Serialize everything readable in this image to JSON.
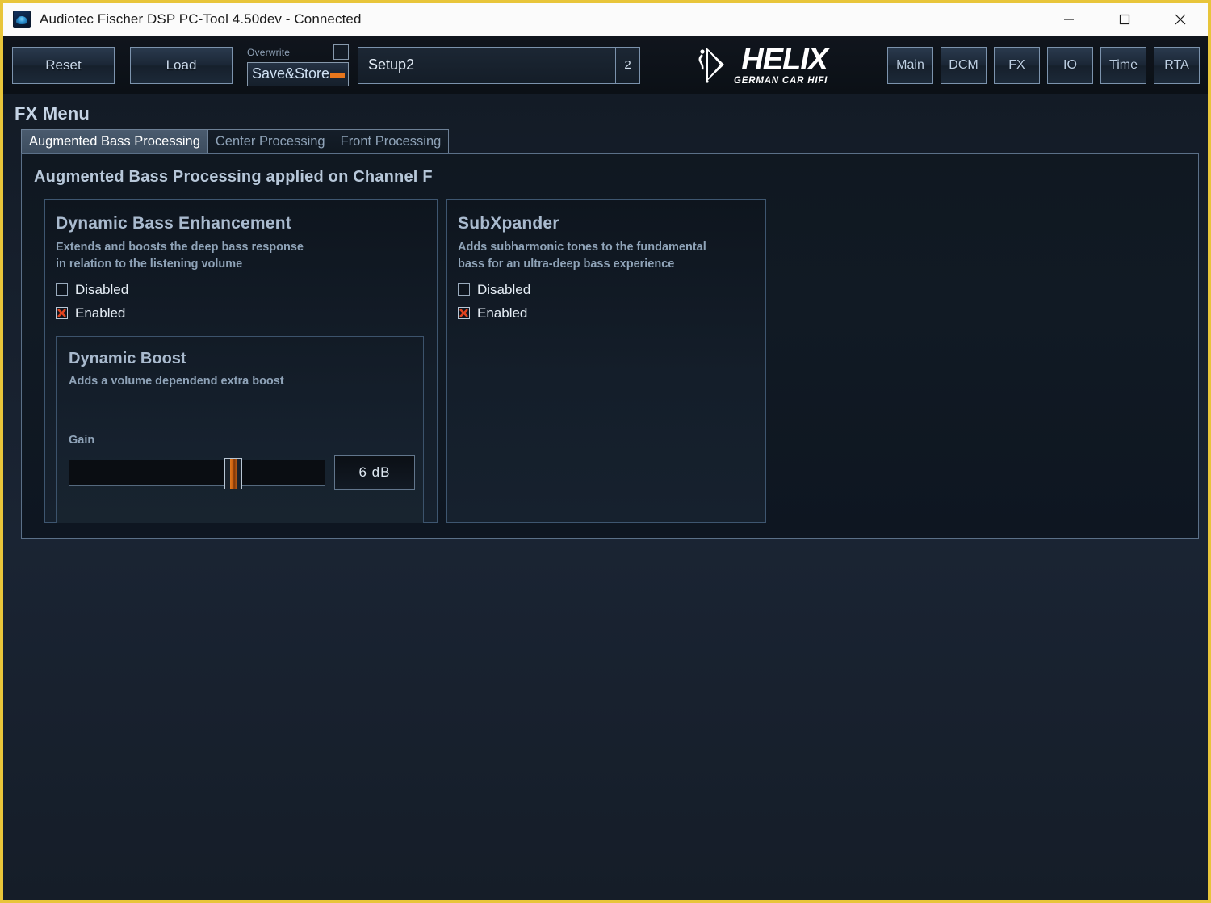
{
  "window": {
    "title": "Audiotec Fischer DSP PC-Tool 4.50dev - Connected",
    "app_icon": "dsp-app-icon",
    "controls": {
      "minimize": "minimize-icon",
      "maximize": "maximize-icon",
      "close": "close-icon"
    },
    "accent_border_color": "#e8c53a"
  },
  "toolbar": {
    "reset_label": "Reset",
    "load_label": "Load",
    "overwrite_label": "Overwrite",
    "overwrite_checked": false,
    "save_store_label": "Save&Store",
    "setup_name": "Setup2",
    "setup_number": "2",
    "logo": {
      "brand": "HELIX",
      "tagline": "GERMAN CAR HIFI"
    },
    "nav_buttons": [
      {
        "label": "Main"
      },
      {
        "label": "DCM"
      },
      {
        "label": "FX"
      },
      {
        "label": "IO"
      },
      {
        "label": "Time"
      },
      {
        "label": "RTA"
      }
    ]
  },
  "page": {
    "title": "FX Menu",
    "tabs": [
      {
        "label": "Augmented Bass Processing",
        "active": true
      },
      {
        "label": "Center Processing",
        "active": false
      },
      {
        "label": "Front Processing",
        "active": false
      }
    ],
    "heading": "Augmented Bass Processing applied on Channel F"
  },
  "dynamic_bass_enhancement": {
    "title": "Dynamic Bass Enhancement",
    "description_line1": "Extends and boosts the deep bass response",
    "description_line2": "in relation to the listening volume",
    "disabled_label": "Disabled",
    "enabled_label": "Enabled",
    "selected": "Enabled",
    "dynamic_boost": {
      "title": "Dynamic Boost",
      "description": "Adds a volume dependend extra boost",
      "gain_label": "Gain",
      "gain_value": "6 dB",
      "gain_percent": 65
    }
  },
  "subxpander": {
    "title": "SubXpander",
    "description_line1": "Adds subharmonic tones to the fundamental",
    "description_line2": "bass for an ultra-deep bass experience",
    "disabled_label": "Disabled",
    "enabled_label": "Enabled",
    "selected": "Enabled"
  },
  "colors": {
    "accent_orange": "#e8761c",
    "check_red": "#e0431f",
    "window_border": "#e8c53a"
  }
}
